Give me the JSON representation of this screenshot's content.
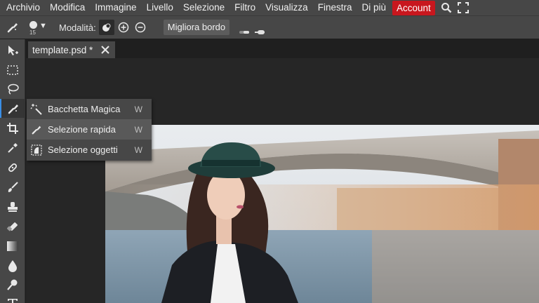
{
  "menubar": {
    "items": [
      "Archivio",
      "Modifica",
      "Immagine",
      "Livello",
      "Selezione",
      "Filtro",
      "Visualizza",
      "Finestra",
      "Di più"
    ],
    "account_label": "Account",
    "icons": [
      "search-icon",
      "fullscreen-icon"
    ]
  },
  "options": {
    "brush_size": "15",
    "mode_label": "Modalità:",
    "refine_label": "Migliora bordo"
  },
  "tab": {
    "title": "template.psd *"
  },
  "toolbar": {
    "tools": [
      "move-tool-icon",
      "marquee-tool-icon",
      "lasso-tool-icon",
      "quick-selection-tool-icon",
      "crop-tool-icon",
      "eyedropper-tool-icon",
      "healing-tool-icon",
      "brush-tool-icon",
      "stamp-tool-icon",
      "eraser-tool-icon",
      "gradient-tool-icon",
      "blur-tool-icon",
      "dodge-tool-icon",
      "text-tool-icon"
    ],
    "active_index": 3
  },
  "flyout": {
    "items": [
      {
        "label": "Bacchetta Magica",
        "key": "W"
      },
      {
        "label": "Selezione rapida",
        "key": "W"
      },
      {
        "label": "Selezione oggetti",
        "key": "W"
      }
    ],
    "highlight_index": 1
  },
  "colors": {
    "bar": "#474747",
    "workspace": "#262626",
    "account": "#c8171e",
    "active_tool_accent": "#3a8ee6"
  }
}
